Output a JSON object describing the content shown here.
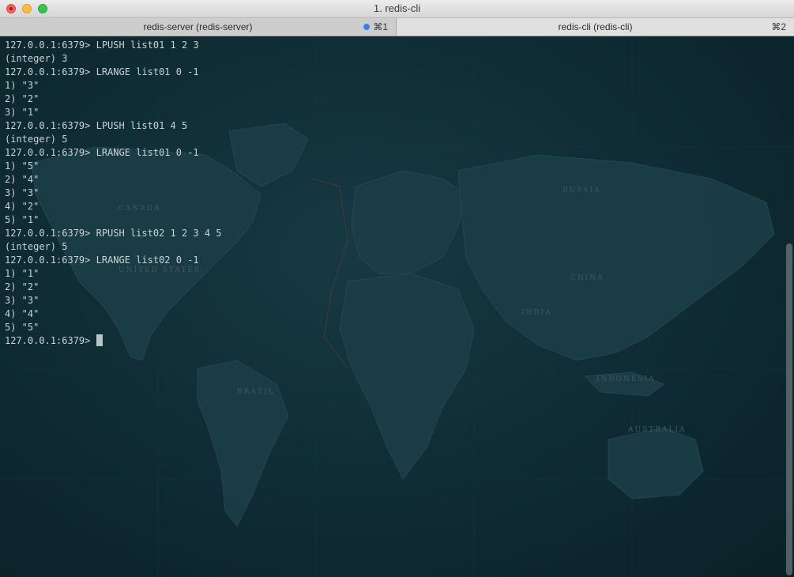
{
  "window": {
    "title": "1. redis-cli"
  },
  "tabs": [
    {
      "label": "redis-server (redis-server)",
      "shortcut": "⌘1",
      "activity_dot_color": "#3c7ef6"
    },
    {
      "label": "redis-cli (redis-cli)",
      "shortcut": "⌘2"
    }
  ],
  "terminal": {
    "lines": [
      "127.0.0.1:6379> LPUSH list01 1 2 3",
      "(integer) 3",
      "127.0.0.1:6379> LRANGE list01 0 -1",
      "1) \"3\"",
      "2) \"2\"",
      "3) \"1\"",
      "127.0.0.1:6379> LPUSH list01 4 5",
      "(integer) 5",
      "127.0.0.1:6379> LRANGE list01 0 -1",
      "1) \"5\"",
      "2) \"4\"",
      "3) \"3\"",
      "4) \"2\"",
      "5) \"1\"",
      "127.0.0.1:6379> RPUSH list02 1 2 3 4 5",
      "(integer) 5",
      "127.0.0.1:6379> LRANGE list02 0 -1",
      "1) \"1\"",
      "2) \"2\"",
      "3) \"3\"",
      "4) \"4\"",
      "5) \"5\""
    ],
    "prompt": "127.0.0.1:6379> ",
    "background_map_labels": [
      "CANADA",
      "UNITED STATES",
      "RUSSIA",
      "CHINA",
      "INDIA",
      "BRAZIL",
      "AUSTRALIA",
      "INDONESIA"
    ]
  },
  "colors": {
    "terminal_bg": "#0f2b33",
    "terminal_fg": "#c9d3d4",
    "land": "#1d4149"
  }
}
